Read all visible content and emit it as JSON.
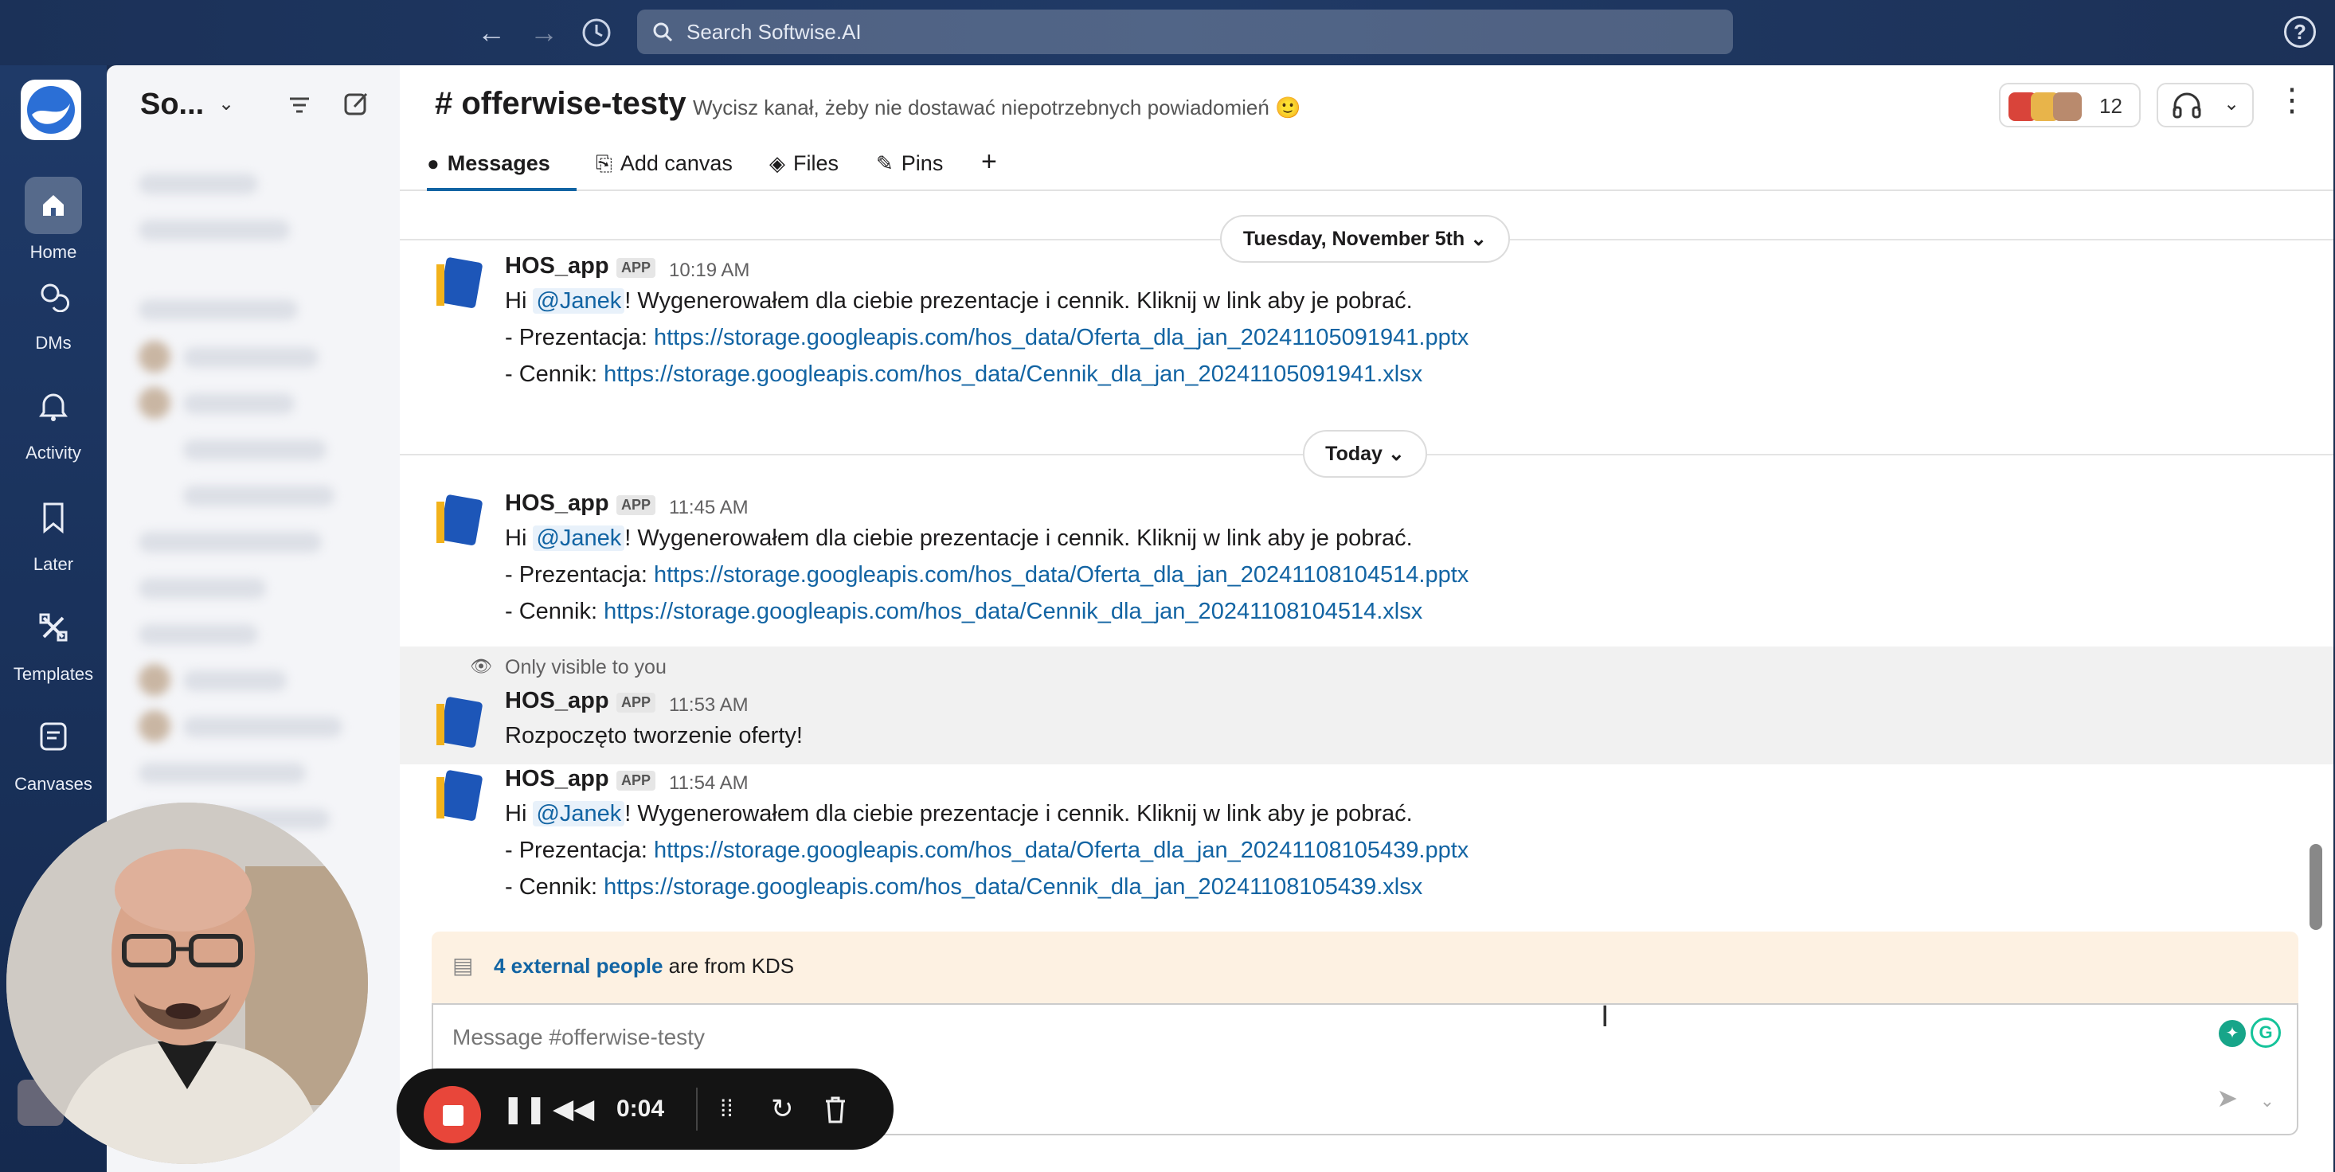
{
  "search": {
    "placeholder": "Search Softwise.AI"
  },
  "topbar": {
    "help": "?"
  },
  "rail": [
    {
      "label": "Home",
      "icon": "home-icon"
    },
    {
      "label": "DMs",
      "icon": "dms-icon"
    },
    {
      "label": "Activity",
      "icon": "bell-icon"
    },
    {
      "label": "Later",
      "icon": "bookmark-icon"
    },
    {
      "label": "Templates",
      "icon": "templates-icon"
    },
    {
      "label": "Canvases",
      "icon": "canvases-icon"
    }
  ],
  "sidebar": {
    "workspace": "So..."
  },
  "channel": {
    "name": "# offerwise-testy",
    "description": "Wycisz kanał, żeby nie dostawać niepotrzebnych powiadomień 🙂",
    "member_count": "12"
  },
  "tabs": [
    {
      "label": "Messages",
      "icon": "message-icon"
    },
    {
      "label": "Add canvas",
      "icon": "canvas-icon"
    },
    {
      "label": "Files",
      "icon": "files-icon"
    },
    {
      "label": "Pins",
      "icon": "pin-icon"
    }
  ],
  "dividers": {
    "d1": "Tuesday, November 5th",
    "d2": "Today"
  },
  "messages": [
    {
      "sender": "HOS_app",
      "badge": "APP",
      "time": "10:19 AM",
      "greet_pre": "Hi ",
      "mention": "@Janek",
      "greet_post": "! Wygenerowałem dla ciebie prezentacje i cennik. Kliknij w link aby je pobrać.",
      "pres_label": "- Prezentacja: ",
      "pres_link": "https://storage.googleapis.com/hos_data/Oferta_dla_jan_20241105091941.pptx",
      "price_label": "- Cennik: ",
      "price_link": "https://storage.googleapis.com/hos_data/Cennik_dla_jan_20241105091941.xlsx"
    },
    {
      "sender": "HOS_app",
      "badge": "APP",
      "time": "11:45 AM",
      "greet_pre": "Hi ",
      "mention": "@Janek",
      "greet_post": "! Wygenerowałem dla ciebie prezentacje i cennik. Kliknij w link aby je pobrać.",
      "pres_label": "- Prezentacja: ",
      "pres_link": "https://storage.googleapis.com/hos_data/Oferta_dla_jan_20241108104514.pptx",
      "price_label": "- Cennik: ",
      "price_link": "https://storage.googleapis.com/hos_data/Cennik_dla_jan_20241108104514.xlsx"
    },
    {
      "only_visible": "Only visible to you",
      "sender": "HOS_app",
      "badge": "APP",
      "time": "11:53 AM",
      "text": "Rozpoczęto tworzenie oferty!"
    },
    {
      "sender": "HOS_app",
      "badge": "APP",
      "time": "11:54 AM",
      "greet_pre": "Hi ",
      "mention": "@Janek",
      "greet_post": "! Wygenerowałem dla ciebie prezentacje i cennik. Kliknij w link aby je pobrać.",
      "pres_label": "- Prezentacja: ",
      "pres_link": "https://storage.googleapis.com/hos_data/Oferta_dla_jan_20241108105439.pptx",
      "price_label": "- Cennik: ",
      "price_link": "https://storage.googleapis.com/hos_data/Cennik_dla_jan_20241108105439.xlsx"
    }
  ],
  "external": {
    "link": "4 external people",
    "rest": " are from KDS"
  },
  "composer": {
    "placeholder": "Message #offerwise-testy"
  },
  "recorder": {
    "time": "0:04"
  },
  "colors": {
    "accent": "#1264a3",
    "rail": "#1f3a68",
    "record": "#e8463a"
  }
}
